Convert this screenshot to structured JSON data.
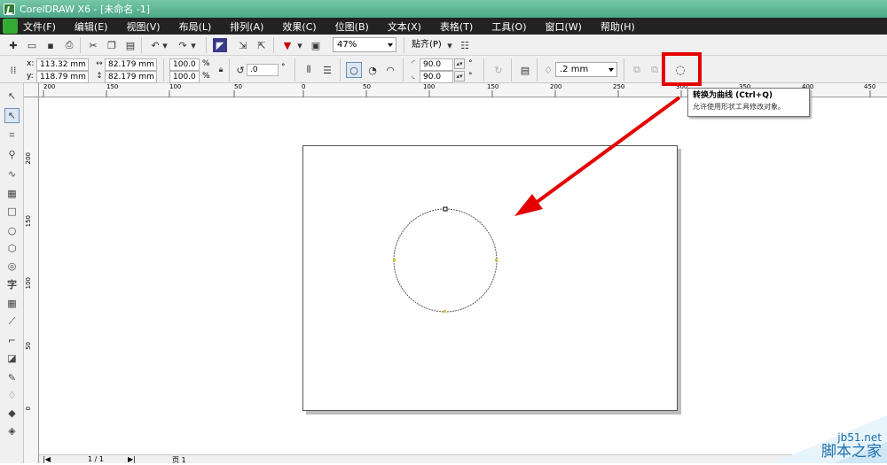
{
  "window": {
    "title": "CorelDRAW X6 - [未命名 -1]"
  },
  "menu": [
    "文件(F)",
    "编辑(E)",
    "视图(V)",
    "布局(L)",
    "排列(A)",
    "效果(C)",
    "位图(B)",
    "文本(X)",
    "表格(T)",
    "工具(O)",
    "窗口(W)",
    "帮助(H)"
  ],
  "standard_toolbar": {
    "zoom": "47%",
    "snap": "贴齐(P)"
  },
  "property_bar": {
    "x_label": "x:",
    "x_value": "113.32 mm",
    "y_label": "y:",
    "y_value": "118.79 mm",
    "w_value": "82.179 mm",
    "h_value": "82.179 mm",
    "scale_x": "100.0",
    "scale_y": "100.0",
    "pct": "%",
    "rotation": ".0",
    "deg": "°",
    "start_angle": "90.0",
    "end_angle": "90.0",
    "outline_width": ".2 mm"
  },
  "ruler": {
    "h_ticks": [
      "200",
      "150",
      "100",
      "50",
      "0",
      "50",
      "100",
      "150",
      "200",
      "250",
      "300",
      "350",
      "400",
      "450"
    ],
    "v_ticks": [
      "200",
      "150",
      "100",
      "50",
      "0"
    ]
  },
  "tooltip": {
    "title": "转换为曲线  (Ctrl+Q)",
    "desc": "允许使用形状工具修改对象。"
  },
  "status": {
    "page_count": "1 / 1",
    "page_tab": "页 1"
  },
  "watermark": {
    "site": "jb51.net",
    "name": "脚本之家"
  },
  "colors": {
    "annotation_red": "#e40000",
    "title_green": "#4ba888",
    "menu_bg": "#222222"
  }
}
